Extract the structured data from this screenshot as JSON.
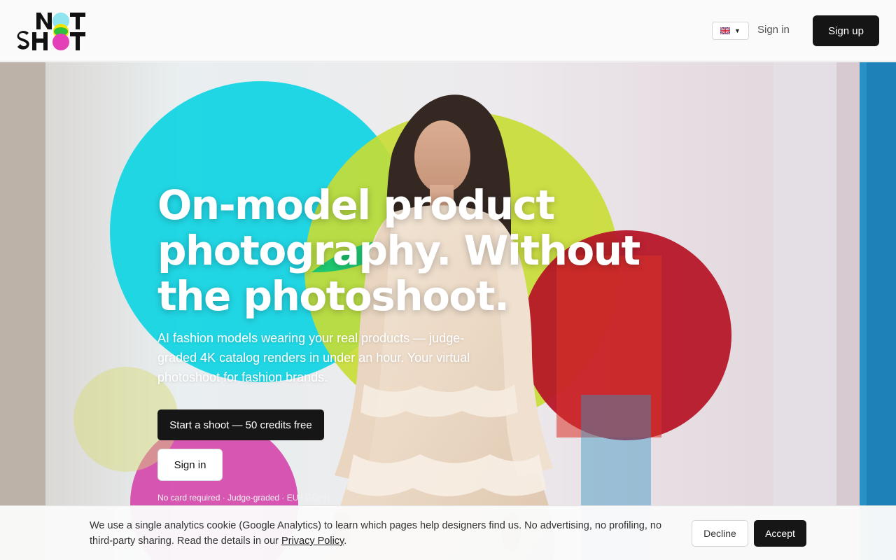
{
  "header": {
    "logo_text": "NOT SHOT",
    "language": {
      "selected": "English",
      "icon": "uk-flag-icon"
    },
    "signin_label": "Sign in",
    "signup_label": "Sign up"
  },
  "hero": {
    "title_line1": "On-model product",
    "title_line2": "photography. Without",
    "title_line3": "the photoshoot.",
    "subtitle": "AI fashion models wearing your real products — judge-graded 4K catalog renders in under an hour. Your virtual photoshoot for fashion brands.",
    "primary_cta": "Start a shoot — 50 credits free",
    "secondary_cta": "Sign in",
    "fineprint": "No card required · Judge-graded · EU / GDPR"
  },
  "cookie_banner": {
    "text": "We use a single analytics cookie (Google Analytics) to learn which pages help designers find us. No advertising, no profiling, no third-party sharing. Read the details in our ",
    "link_label": "Privacy Policy",
    "end": ".",
    "decline_label": "Decline",
    "accept_label": "Accept"
  },
  "colors": {
    "primary_button": "#161616",
    "cyan_circle": "#10d4e0",
    "lime_circle": "#c8dd2a",
    "red_circle": "#b80a1c",
    "magenta_circle": "#d43fa8"
  }
}
